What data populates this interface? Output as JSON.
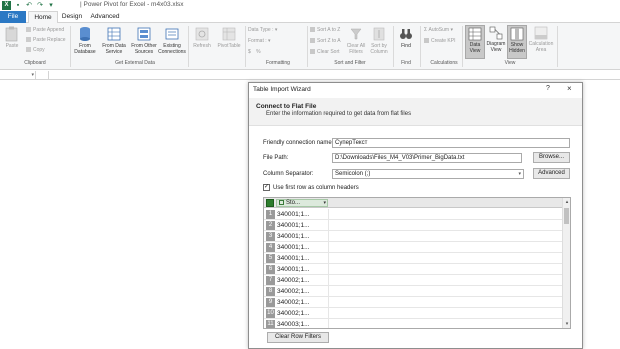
{
  "window": {
    "title": "| Power Pivot for Excel - m4x03.xlsx"
  },
  "tabs": {
    "file": "File",
    "home": "Home",
    "design": "Design",
    "advanced": "Advanced"
  },
  "ribbon": {
    "paste": "Paste",
    "paste_append": "Paste Append",
    "paste_replace": "Paste Replace",
    "copy": "Copy",
    "from_database": [
      "From",
      "Database"
    ],
    "from_data_service": [
      "From Data",
      "Service"
    ],
    "from_other_sources": [
      "From Other",
      "Sources"
    ],
    "existing_connections": [
      "Existing",
      "Connections"
    ],
    "refresh": "Refresh",
    "pivottable": "PivotTable",
    "data_type": "Data Type :",
    "format": "Format :",
    "sort_a_to_z": "Sort A to Z",
    "sort_z_to_a": "Sort Z to A",
    "clear_sort": "Clear Sort",
    "clear_all_filters": [
      "Clear All",
      "Filters"
    ],
    "sort_by_column": [
      "Sort by",
      "Column"
    ],
    "find": "Find",
    "autosum": "AutoSum",
    "create_kpi": "Create KPI",
    "data_view": [
      "Data",
      "View"
    ],
    "diagram_view": [
      "Diagram",
      "View"
    ],
    "show_hidden": [
      "Show",
      "Hidden"
    ],
    "calculation_area": [
      "Calculation",
      "Area"
    ],
    "groups": {
      "clipboard": "Clipboard",
      "get_external_data": "Get External Data",
      "formatting": "Formatting",
      "sort_and_filter": "Sort and Filter",
      "find": "Find",
      "calculations": "Calculations",
      "view": "View"
    }
  },
  "dialog": {
    "title": "Table Import Wizard",
    "help": "?",
    "close": "×",
    "heading": "Connect to Flat File",
    "subheading": "Enter the information required to get data from flat files",
    "friendly_label": "Friendly connection name:",
    "friendly_value": "СуперТекст",
    "file_path_label": "File Path:",
    "file_path_value": "D:\\Downloads\\Files_M4_V03\\Primer_BigData.txt",
    "browse": "Browse...",
    "separator_label": "Column Separator:",
    "separator_value": "Semicolon (;)",
    "advanced": "Advanced",
    "first_row_header": "Use first row as column headers",
    "first_row_checked": true,
    "column_header": "Sto...",
    "rows": [
      {
        "n": "1",
        "v": "340001;1..."
      },
      {
        "n": "2",
        "v": "340001;1..."
      },
      {
        "n": "3",
        "v": "340001;1..."
      },
      {
        "n": "4",
        "v": "340001;1..."
      },
      {
        "n": "5",
        "v": "340001;1..."
      },
      {
        "n": "6",
        "v": "340001;1..."
      },
      {
        "n": "7",
        "v": "340002;1..."
      },
      {
        "n": "8",
        "v": "340002;1..."
      },
      {
        "n": "9",
        "v": "340002;1..."
      },
      {
        "n": "10",
        "v": "340002;1..."
      },
      {
        "n": "11",
        "v": "340003;1..."
      }
    ],
    "clear_row_filters": "Clear Row Filters"
  }
}
